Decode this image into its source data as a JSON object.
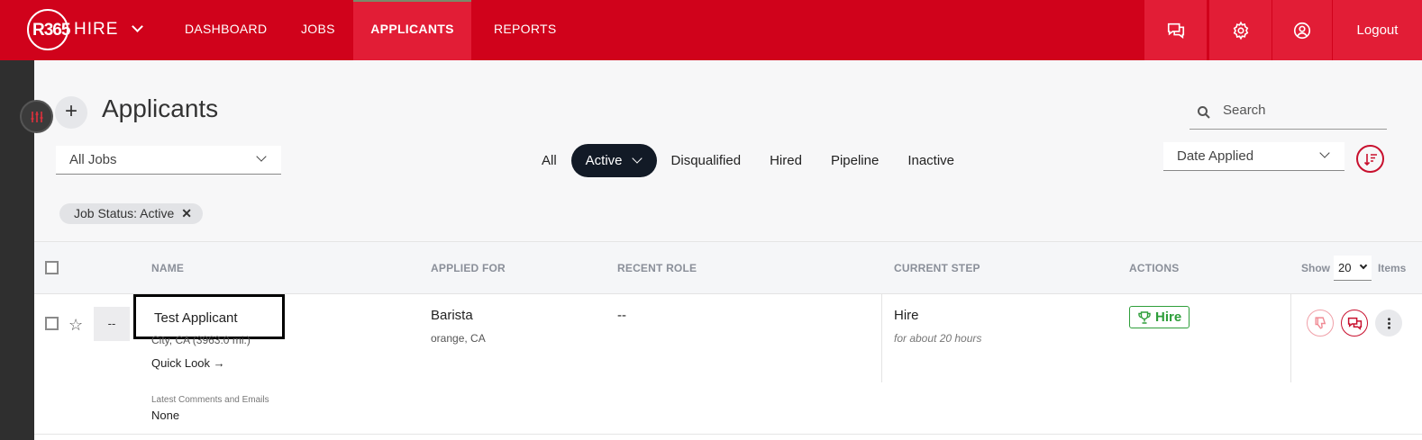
{
  "app": {
    "logo_prefix": "R365",
    "logo_suffix": "HIRE"
  },
  "nav": [
    {
      "label": "DASHBOARD"
    },
    {
      "label": "JOBS"
    },
    {
      "label": "APPLICANTS"
    },
    {
      "label": "REPORTS"
    }
  ],
  "topbar": {
    "logout_label": "Logout",
    "icons": [
      "chat-icon",
      "gear-icon",
      "user-icon"
    ]
  },
  "page": {
    "title": "Applicants"
  },
  "search": {
    "placeholder": "Search",
    "value": ""
  },
  "jobs_filter": {
    "value": "All Jobs"
  },
  "status_tabs": [
    {
      "label": "All"
    },
    {
      "label": "Active"
    },
    {
      "label": "Disqualified"
    },
    {
      "label": "Hired"
    },
    {
      "label": "Pipeline"
    },
    {
      "label": "Inactive"
    }
  ],
  "sort": {
    "value": "Date Applied"
  },
  "chips": [
    {
      "label": "Job Status: Active"
    }
  ],
  "table": {
    "headers": {
      "name": "NAME",
      "applied_for": "APPLIED FOR",
      "recent_role": "RECENT ROLE",
      "current_step": "CURRENT STEP",
      "actions": "ACTIONS"
    },
    "show_label": "Show",
    "page_size": "20",
    "items_label": "Items",
    "rows": [
      {
        "avatar": "--",
        "name": "Test Applicant",
        "location": "City, CA (3963.0 mi.)",
        "quick_look": "Quick Look →",
        "comments_label": "Latest Comments and Emails",
        "comments_value": "None",
        "applied_for": "Barista",
        "applied_location": "orange, CA",
        "recent_role": "--",
        "current_step": "Hire",
        "step_time": "for about 20 hours",
        "hire_label": "Hire"
      }
    ]
  },
  "colors": {
    "brand_red": "#d0021b",
    "active_tab": "#121a26",
    "hire_green": "#2e9e3a"
  }
}
